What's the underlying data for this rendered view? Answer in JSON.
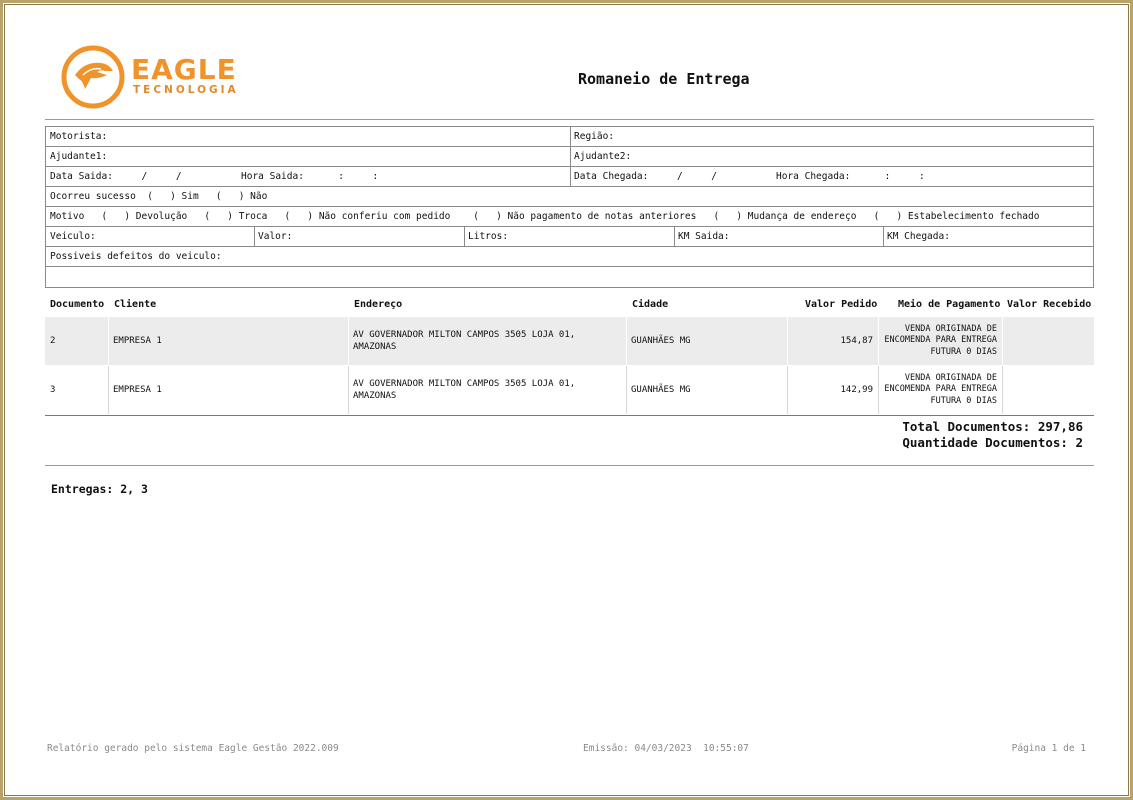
{
  "logo": {
    "word": "EAGLE",
    "sub": "TECNOLOGIA",
    "accent": "#f0932b"
  },
  "title": "Romaneio de Entrega",
  "form": {
    "motorista": "Motorista:",
    "regiao": "Região:",
    "ajudante1": "Ajudante1:",
    "ajudante2": "Ajudante2:",
    "data_saida": "Data Saida:     /     /",
    "hora_saida": "Hora Saida:      :     :",
    "data_chegada": "Data Chegada:     /     /",
    "hora_chegada": "Hora Chegada:      :     :",
    "ocorreu": "Ocorreu sucesso  (   ) Sim   (   ) Não",
    "motivo": "Motivo   (   ) Devolução   (   ) Troca   (   ) Não conferiu com pedido    (   ) Não pagamento de notas anteriores   (   ) Mudança de endereço   (   ) Estabelecimento fechado",
    "veiculo": "Veiculo:",
    "valor": "Valor:",
    "litros": "Litros:",
    "km_saida": "KM Saida:",
    "km_chegada": "KM Chegada:",
    "defeitos": "Possiveis defeitos do veiculo:"
  },
  "table": {
    "headers": {
      "documento": "Documento",
      "cliente": "Cliente",
      "endereco": "Endereço",
      "cidade": "Cidade",
      "valor_pedido": "Valor Pedido",
      "meio_pagamento": "Meio de Pagamento",
      "valor_recebido": "Valor Recebido"
    },
    "rows": [
      {
        "documento": "2",
        "cliente": "EMPRESA 1",
        "endereco": "AV GOVERNADOR MILTON CAMPOS 3505 LOJA 01, AMAZONAS",
        "cidade": "GUANHÃES MG",
        "valor_pedido": "154,87",
        "meio_pagamento": "VENDA ORIGINADA DE ENCOMENDA PARA ENTREGA FUTURA 0 DIAS",
        "valor_recebido": ""
      },
      {
        "documento": "3",
        "cliente": "EMPRESA 1",
        "endereco": "AV GOVERNADOR MILTON CAMPOS 3505 LOJA 01, AMAZONAS",
        "cidade": "GUANHÃES MG",
        "valor_pedido": "142,99",
        "meio_pagamento": "VENDA ORIGINADA DE ENCOMENDA PARA ENTREGA FUTURA 0 DIAS",
        "valor_recebido": ""
      }
    ]
  },
  "totals": {
    "total_documentos": "Total Documentos: 297,86",
    "quantidade_documentos": "Quantidade Documentos: 2"
  },
  "entregas": "Entregas: 2, 3",
  "footer": {
    "left": "Relatório gerado pelo sistema Eagle Gestão 2022.009",
    "center": "Emissão: 04/03/2023  10:55:07",
    "right": "Página 1 de 1"
  }
}
